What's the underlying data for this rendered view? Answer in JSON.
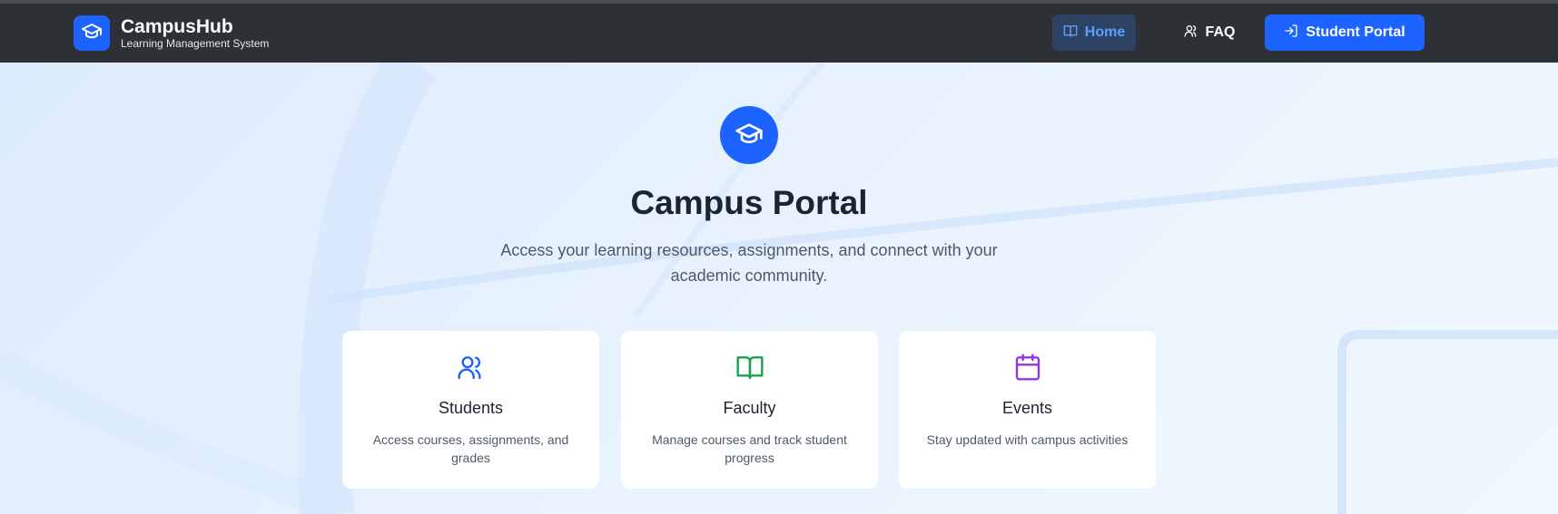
{
  "brand": {
    "name": "CampusHub",
    "subtitle": "Learning Management System",
    "logo_icon": "graduation-cap-icon",
    "color": "#1d63ff"
  },
  "nav": {
    "home_label": "Home",
    "faq_label": "FAQ",
    "portal_label": "Student Portal",
    "active": "Home"
  },
  "hero": {
    "icon": "graduation-cap-icon",
    "title": "Campus Portal",
    "description": "Access your learning resources, assignments, and connect with your academic community."
  },
  "cards": [
    {
      "icon": "users-icon",
      "icon_color": "#1d63ff",
      "title": "Students",
      "description": "Access courses, assignments, and grades"
    },
    {
      "icon": "book-open-icon",
      "icon_color": "#16a34a",
      "title": "Faculty",
      "description": "Manage courses and track student progress"
    },
    {
      "icon": "calendar-icon",
      "icon_color": "#9333ea",
      "title": "Events",
      "description": "Stay updated with campus activities"
    }
  ]
}
